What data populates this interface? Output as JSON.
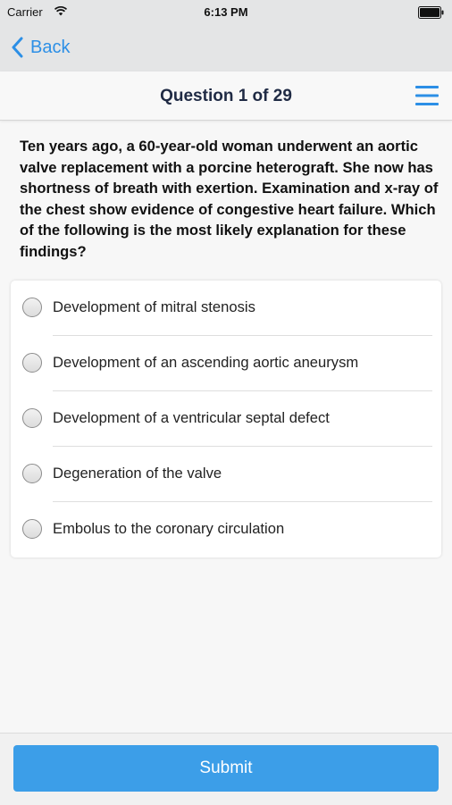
{
  "status_bar": {
    "carrier": "Carrier",
    "time": "6:13 PM",
    "wifi_icon": "wifi-icon",
    "battery_icon": "battery-icon"
  },
  "nav": {
    "back_label": "Back",
    "back_icon": "chevron-left-icon"
  },
  "header": {
    "title": "Question 1 of 29",
    "menu_icon": "hamburger-menu-icon"
  },
  "question": {
    "text": "Ten years ago, a 60-year-old woman underwent an aortic valve replacement with a porcine heterograft. She now has shortness of breath with exertion. Examination and x-ray of the chest show evidence of congestive heart failure. Which of the following is the most likely explanation for these findings?"
  },
  "options": [
    {
      "label": "Development of mitral stenosis",
      "selected": false
    },
    {
      "label": "Development of an ascending aortic aneurysm",
      "selected": false
    },
    {
      "label": "Development of a ventricular septal defect",
      "selected": false
    },
    {
      "label": "Degeneration of the valve",
      "selected": false
    },
    {
      "label": "Embolus to the coronary circulation",
      "selected": false
    }
  ],
  "footer": {
    "submit_label": "Submit"
  },
  "colors": {
    "accent": "#2c8fe6",
    "submit_bg": "#3c9ee8",
    "title_text": "#1f2a44",
    "bar_bg": "#e4e5e6"
  }
}
